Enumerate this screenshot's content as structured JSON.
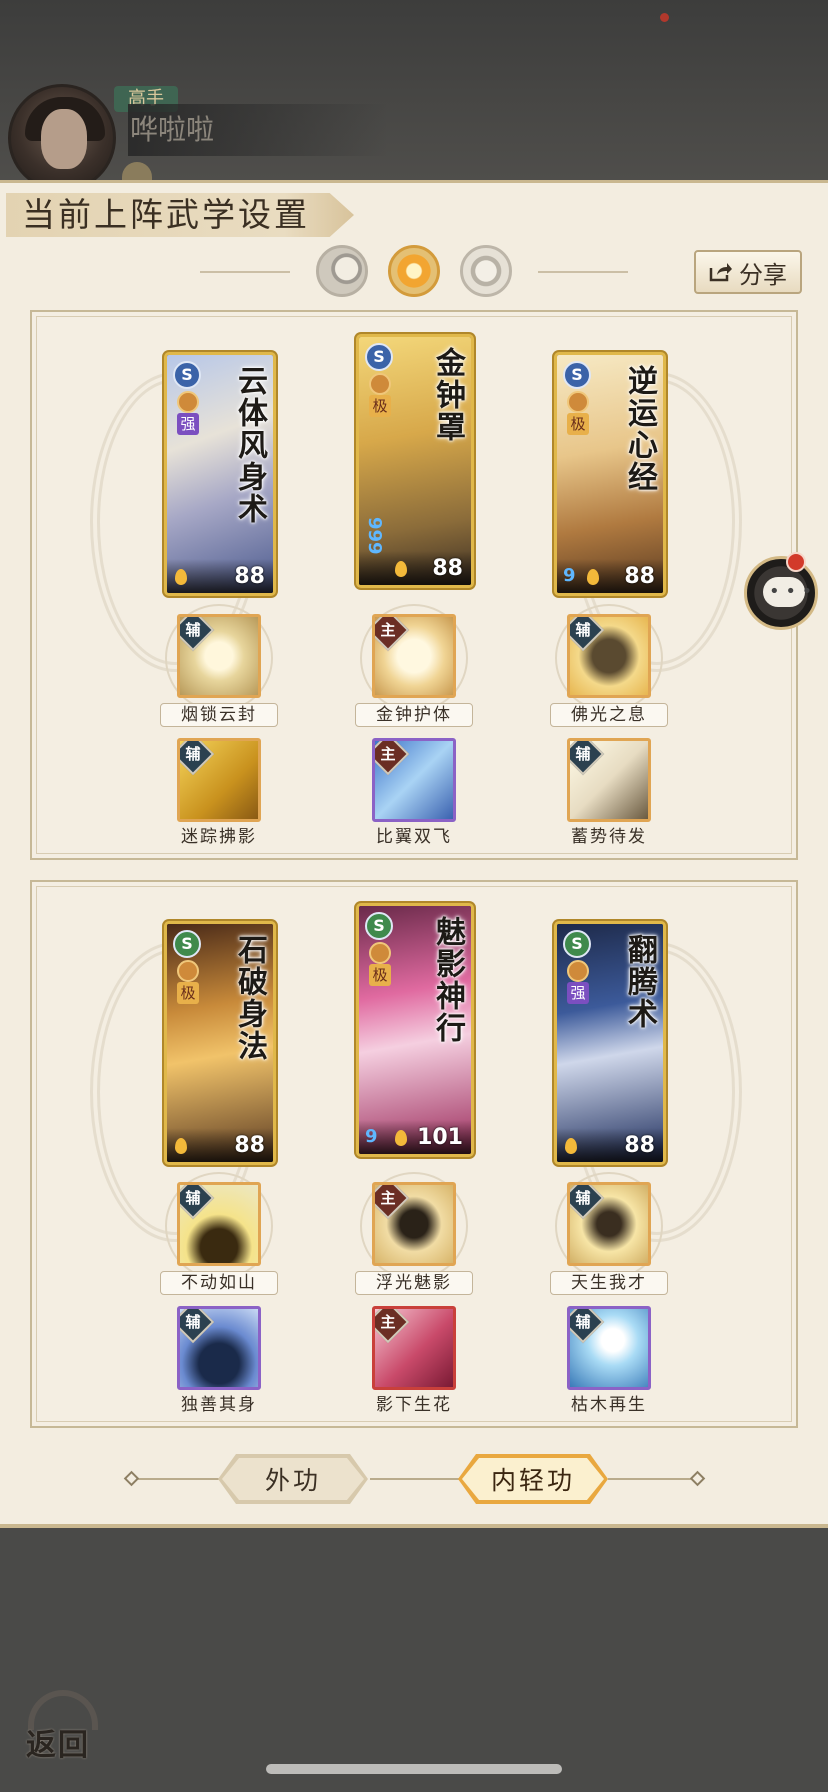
{
  "header": {
    "rank": "高手",
    "player_name": "哗啦啦"
  },
  "panel": {
    "title": "当前上阵武学设置",
    "share_label": "分享"
  },
  "selector": {
    "active": "sun",
    "items": [
      "moon-icon",
      "sun-icon",
      "ring-icon"
    ]
  },
  "group1": {
    "cards": [
      {
        "name": "云体风身术",
        "school": "S",
        "grade_label": "强",
        "power": "88",
        "stars": ""
      },
      {
        "name": "金钟罩",
        "school": "S",
        "grade_label": "极",
        "power": "88",
        "stars": "999"
      },
      {
        "name": "逆运心经",
        "school": "S",
        "grade_label": "极",
        "power": "88",
        "stars": "9"
      }
    ],
    "skills_row1": [
      {
        "tag": "辅",
        "label": "烟锁云封"
      },
      {
        "tag": "主",
        "label": "金钟护体"
      },
      {
        "tag": "辅",
        "label": "佛光之息"
      }
    ],
    "skills_row2": [
      {
        "tag": "辅",
        "label": "迷踪拂影"
      },
      {
        "tag": "主",
        "label": "比翼双飞"
      },
      {
        "tag": "辅",
        "label": "蓄势待发"
      }
    ]
  },
  "group2": {
    "cards": [
      {
        "name": "石破身法",
        "school": "S",
        "grade_label": "极",
        "power": "88",
        "stars": ""
      },
      {
        "name": "魅影神行",
        "school": "S",
        "grade_label": "极",
        "power": "101",
        "stars": "9"
      },
      {
        "name": "翻腾术",
        "school": "S",
        "grade_label": "强",
        "power": "88",
        "stars": ""
      }
    ],
    "skills_row1": [
      {
        "tag": "辅",
        "label": "不动如山"
      },
      {
        "tag": "主",
        "label": "浮光魅影"
      },
      {
        "tag": "辅",
        "label": "天生我才"
      }
    ],
    "skills_row2": [
      {
        "tag": "辅",
        "label": "独善其身"
      },
      {
        "tag": "主",
        "label": "影下生花"
      },
      {
        "tag": "辅",
        "label": "枯木再生"
      }
    ]
  },
  "tabs": [
    {
      "label": "外功",
      "active": false
    },
    {
      "label": "内轻功",
      "active": true
    }
  ],
  "back_label": "返回",
  "colors": {
    "panel_bg": "#f3ede0",
    "gold_frame": "#e0b84a",
    "active_tab": "#e9a83f"
  }
}
